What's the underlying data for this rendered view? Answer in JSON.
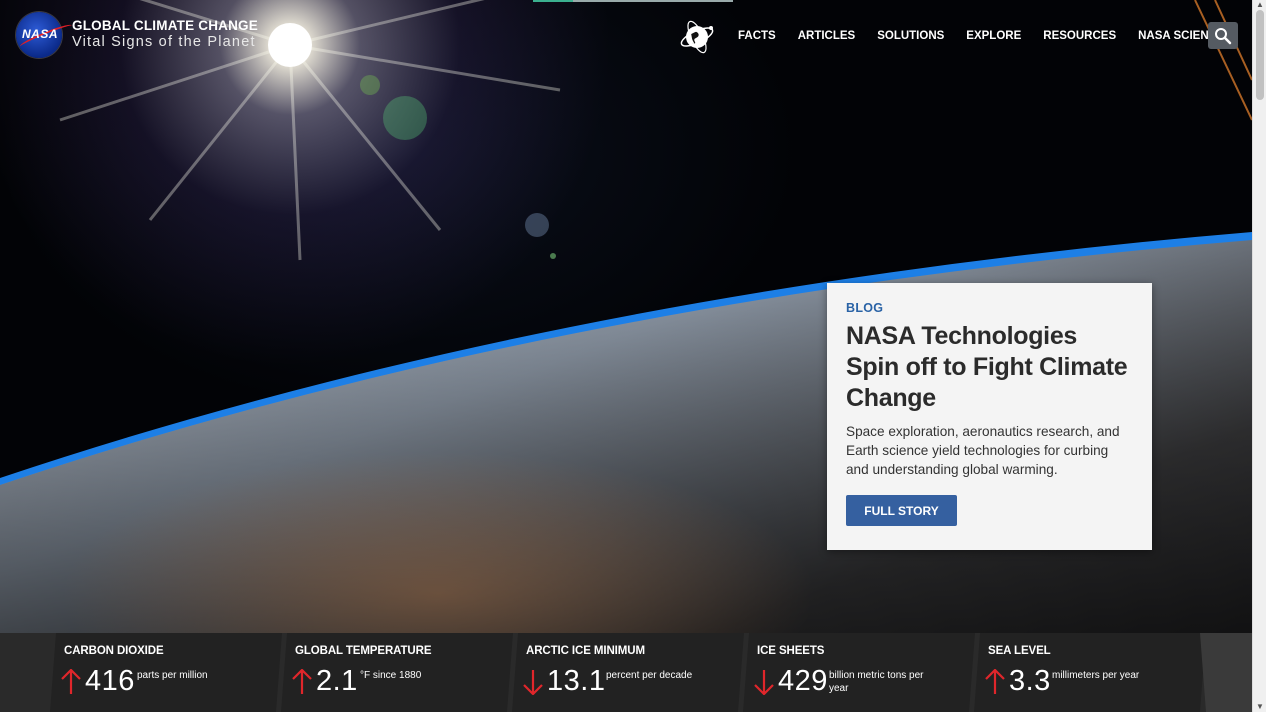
{
  "header": {
    "logo_text": "NASA",
    "title": "GLOBAL CLIMATE CHANGE",
    "subtitle": "Vital Signs of the Planet",
    "nav": [
      "FACTS",
      "ARTICLES",
      "SOLUTIONS",
      "EXPLORE",
      "RESOURCES",
      "NASA SCIENCE"
    ],
    "search_icon": "search-icon",
    "globe_icon": "globe-icon"
  },
  "feature": {
    "category": "BLOG",
    "title": "NASA Technologies Spin off to Fight Climate Change",
    "description": "Space exploration, aeronautics research, and Earth science yield technologies for curbing and understanding global warming.",
    "button": "FULL STORY"
  },
  "vitals": [
    {
      "label": "CARBON DIOXIDE",
      "direction": "up",
      "value": "416",
      "unit": "parts per million"
    },
    {
      "label": "GLOBAL TEMPERATURE",
      "direction": "up",
      "value": "2.1",
      "unit": "°F since 1880"
    },
    {
      "label": "ARCTIC ICE MINIMUM",
      "direction": "down",
      "value": "13.1",
      "unit": "percent per decade"
    },
    {
      "label": "ICE SHEETS",
      "direction": "down",
      "value": "429",
      "unit": "billion metric tons per year"
    },
    {
      "label": "SEA LEVEL",
      "direction": "up",
      "value": "3.3",
      "unit": "millimeters per year"
    }
  ],
  "colors": {
    "accent_blue": "#3560a0",
    "category_blue": "#2a63a6",
    "arrow_red": "#e0262b"
  }
}
